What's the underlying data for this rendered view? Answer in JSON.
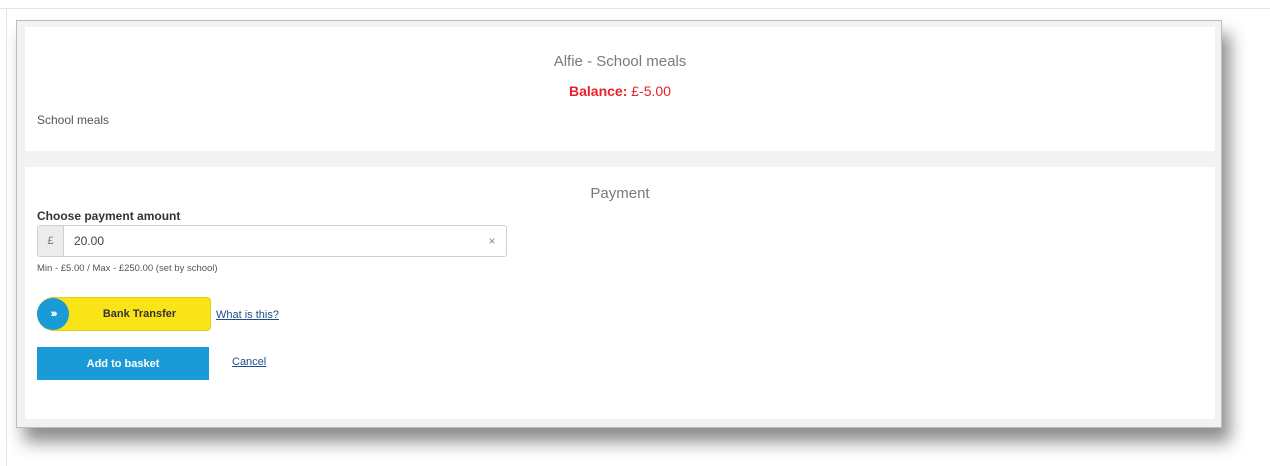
{
  "account": {
    "title": "Alfie - School meals",
    "balance_label": "Balance:",
    "balance_value": "£-5.00",
    "description": "School meals"
  },
  "payment": {
    "heading": "Payment",
    "amount_label": "Choose payment amount",
    "currency_symbol": "£",
    "amount_value": "20.00",
    "clear_symbol": "×",
    "limits_text": "Min - £5.00 / Max - £250.00 (set by school)",
    "bank_transfer_label": "Bank Transfer",
    "bank_transfer_icon": "chevrons-right-icon",
    "bank_icon_glyph": "›››",
    "what_is_this_label": "What is this?",
    "add_to_basket_label": "Add to basket",
    "cancel_label": "Cancel"
  },
  "colors": {
    "balance_red": "#e8222a",
    "primary_blue": "#1a9ad6",
    "bank_yellow": "#f9e418",
    "link_blue": "#1f4e8c"
  }
}
